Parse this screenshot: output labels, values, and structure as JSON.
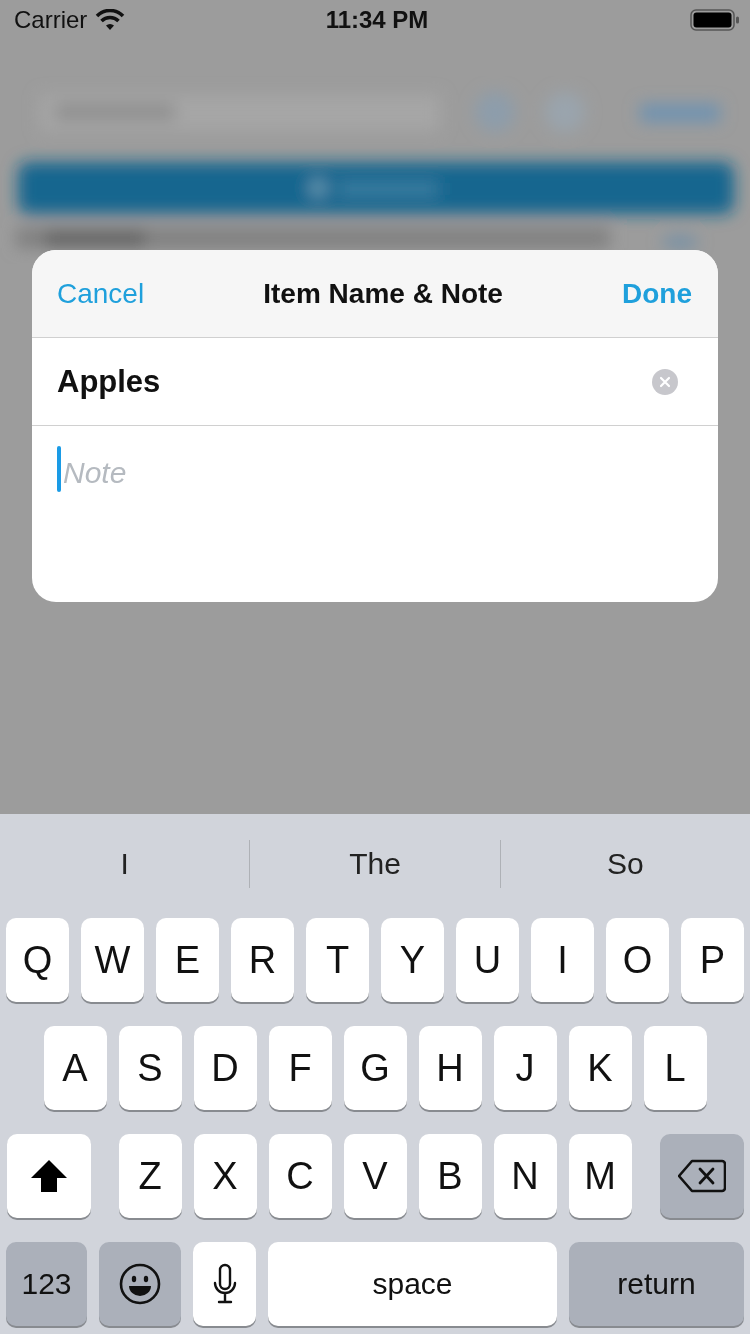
{
  "status_bar": {
    "carrier": "Carrier",
    "time": "11:34 PM"
  },
  "dialog": {
    "title": "Item Name & Note",
    "cancel": "Cancel",
    "done": "Done",
    "name_field": {
      "value": "Apples"
    },
    "note_field": {
      "placeholder": "Note",
      "focused": true
    }
  },
  "keyboard": {
    "suggestions": [
      "I",
      "The",
      "So"
    ],
    "rows": [
      {
        "keys": [
          {
            "kind": "letter",
            "label": "Q"
          },
          {
            "kind": "letter",
            "label": "W"
          },
          {
            "kind": "letter",
            "label": "E"
          },
          {
            "kind": "letter",
            "label": "R"
          },
          {
            "kind": "letter",
            "label": "T"
          },
          {
            "kind": "letter",
            "label": "Y"
          },
          {
            "kind": "letter",
            "label": "U"
          },
          {
            "kind": "letter",
            "label": "I"
          },
          {
            "kind": "letter",
            "label": "O"
          },
          {
            "kind": "letter",
            "label": "P"
          }
        ]
      },
      {
        "keys": [
          {
            "kind": "letter",
            "label": "A"
          },
          {
            "kind": "letter",
            "label": "S"
          },
          {
            "kind": "letter",
            "label": "D"
          },
          {
            "kind": "letter",
            "label": "F"
          },
          {
            "kind": "letter",
            "label": "G"
          },
          {
            "kind": "letter",
            "label": "H"
          },
          {
            "kind": "letter",
            "label": "J"
          },
          {
            "kind": "letter",
            "label": "K"
          },
          {
            "kind": "letter",
            "label": "L"
          }
        ]
      },
      {
        "keys": [
          {
            "kind": "shift"
          },
          {
            "kind": "letter",
            "label": "Z"
          },
          {
            "kind": "letter",
            "label": "X"
          },
          {
            "kind": "letter",
            "label": "C"
          },
          {
            "kind": "letter",
            "label": "V"
          },
          {
            "kind": "letter",
            "label": "B"
          },
          {
            "kind": "letter",
            "label": "N"
          },
          {
            "kind": "letter",
            "label": "M"
          },
          {
            "kind": "delete"
          }
        ]
      },
      {
        "keys": [
          {
            "kind": "numbers",
            "label": "123"
          },
          {
            "kind": "emoji"
          },
          {
            "kind": "mic"
          },
          {
            "kind": "space",
            "label": "space"
          },
          {
            "kind": "return",
            "label": "return"
          }
        ]
      }
    ]
  }
}
